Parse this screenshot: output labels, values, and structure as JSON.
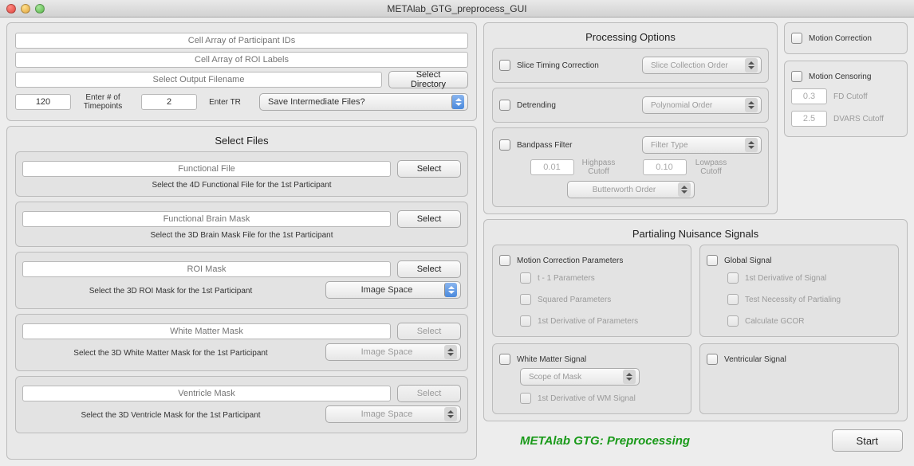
{
  "window": {
    "title": "METAlab_GTG_preprocess_GUI"
  },
  "top": {
    "participant_ids_ph": "Cell Array of Participant IDs",
    "roi_labels_ph": "Cell Array of ROI Labels",
    "output_filename_ph": "Select Output Filename",
    "select_directory_btn": "Select Directory",
    "num_timepoints_value": "120",
    "num_timepoints_label": "Enter # of Timepoints",
    "tr_value": "2",
    "tr_label": "Enter TR",
    "save_intermediate_label": "Save Intermediate Files?"
  },
  "select_files": {
    "heading": "Select Files",
    "select_btn": "Select",
    "functional": {
      "placeholder": "Functional File",
      "hint": "Select the 4D Functional File for the 1st Participant"
    },
    "brain_mask": {
      "placeholder": "Functional Brain Mask",
      "hint": "Select the 3D Brain Mask File for the 1st Participant"
    },
    "roi_mask": {
      "placeholder": "ROI Mask",
      "hint": "Select the 3D ROI Mask for the 1st Participant",
      "image_space": "Image Space"
    },
    "wm_mask": {
      "placeholder": "White Matter Mask",
      "hint": "Select the 3D White Matter Mask for the 1st Participant",
      "image_space": "Image Space"
    },
    "vent_mask": {
      "placeholder": "Ventricle Mask",
      "hint": "Select the 3D Ventricle Mask for the 1st Participant",
      "image_space": "Image Space"
    }
  },
  "processing": {
    "heading": "Processing Options",
    "slice_timing": "Slice Timing Correction",
    "slice_order_ph": "Slice Collection Order",
    "detrending": "Detrending",
    "poly_order_ph": "Polynomial Order",
    "bandpass": "Bandpass Filter",
    "filter_type_ph": "Filter Type",
    "highpass_value": "0.01",
    "highpass_label": "Highpass Cutoff",
    "lowpass_value": "0.10",
    "lowpass_label": "Lowpass Cutoff",
    "butterworth_ph": "Butterworth Order",
    "motion_correction": "Motion Correction",
    "motion_censoring": "Motion Censoring",
    "fd_value": "0.3",
    "fd_label": "FD Cutoff",
    "dvars_value": "2.5",
    "dvars_label": "DVARS Cutoff"
  },
  "partialing": {
    "heading": "Partialing Nuisance Signals",
    "motion_params": "Motion Correction Parameters",
    "t1": "t - 1 Parameters",
    "squared": "Squared Parameters",
    "first_deriv": "1st Derivative of Parameters",
    "global_signal": "Global Signal",
    "first_deriv_signal": "1st Derivative of Signal",
    "test_necessity": "Test Necessity of Partialing",
    "gcor": "Calculate GCOR",
    "wm_signal": "White Matter Signal",
    "scope_of_mask_ph": "Scope of Mask",
    "first_deriv_wm": "1st Derivative of WM Signal",
    "vent_signal": "Ventricular Signal"
  },
  "footer": {
    "brand": "METAlab GTG: Preprocessing",
    "start": "Start"
  }
}
